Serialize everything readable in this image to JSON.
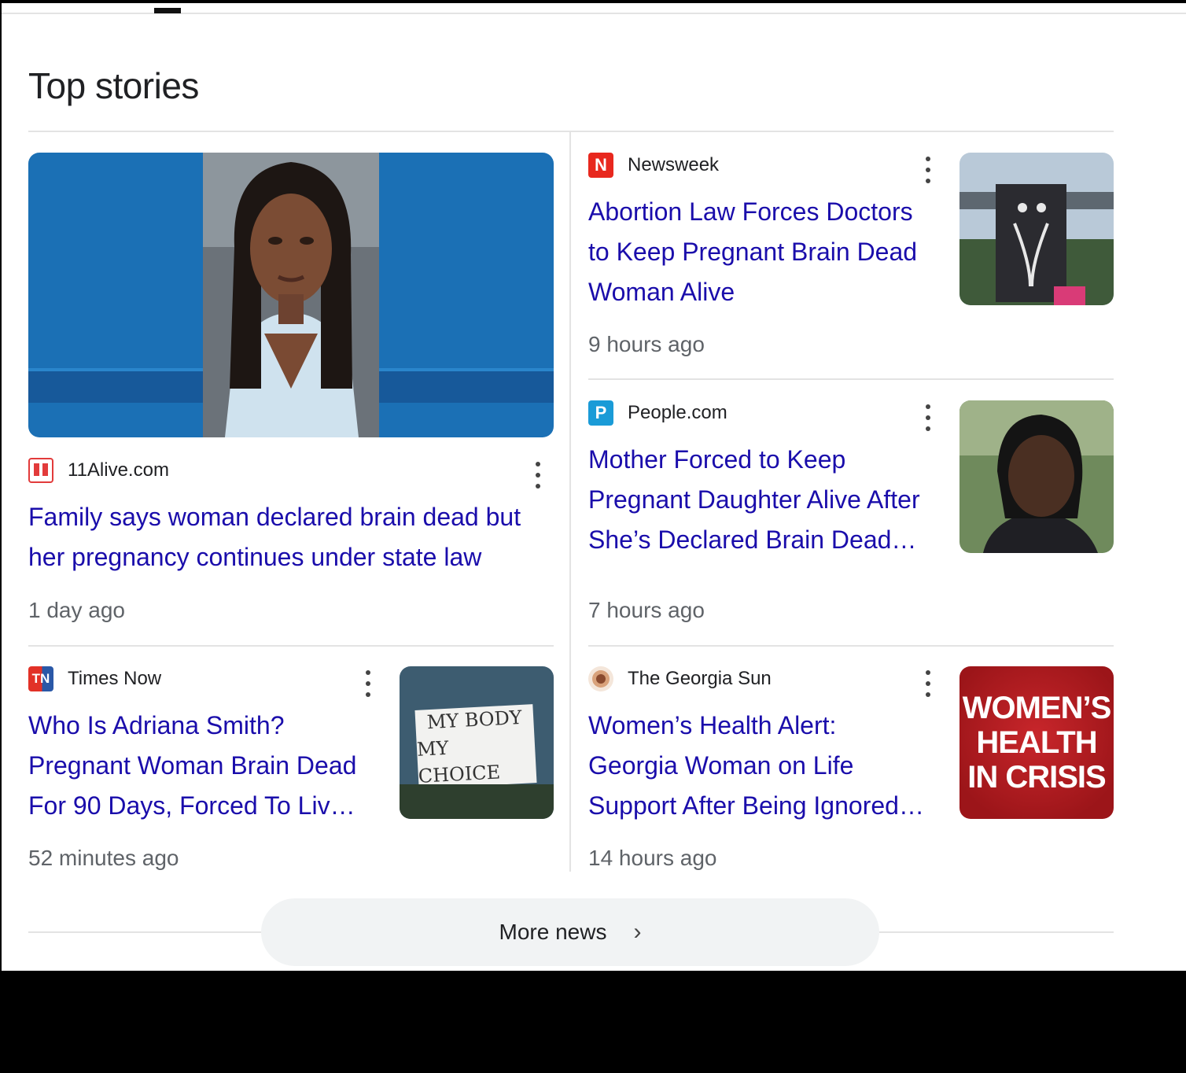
{
  "section_title": "Top stories",
  "stories": [
    {
      "source": "11Alive.com",
      "source_icon": "11alive-logo-icon",
      "headline_lines": [
        "Family says woman declared brain dead but",
        "her pregnancy continues under state law"
      ],
      "time": "1 day ago"
    },
    {
      "source": "Newsweek",
      "source_icon": "newsweek-logo-icon",
      "icon_letter": "N",
      "headline_lines": [
        "Abortion Law Forces Doctors",
        "to Keep Pregnant Brain Dead",
        "Woman Alive"
      ],
      "time": "9 hours ago"
    },
    {
      "source": "People.com",
      "source_icon": "people-logo-icon",
      "icon_letter": "P",
      "headline_lines": [
        "Mother Forced to Keep",
        "Pregnant Daughter Alive After",
        "She’s Declared Brain Dead…"
      ],
      "time": "7 hours ago"
    },
    {
      "source": "Times Now",
      "source_icon": "timesnow-logo-icon",
      "icon_letter": "TN",
      "headline_lines": [
        "Who Is Adriana Smith?",
        "Pregnant Woman Brain Dead",
        "For 90 Days, Forced To Liv…"
      ],
      "time": "52 minutes ago",
      "image_text": [
        "MY BODY",
        "MY CHOICE"
      ]
    },
    {
      "source": "The Georgia Sun",
      "source_icon": "georgiasun-logo-icon",
      "headline_lines": [
        "Women’s Health Alert:",
        "Georgia Woman on Life",
        "Support After Being Ignored…"
      ],
      "time": "14 hours ago",
      "image_text": [
        "WOMEN’S",
        "HEALTH",
        "IN CRISIS"
      ]
    }
  ],
  "more_news": {
    "label": "More news",
    "icon": "chevron-right-icon"
  },
  "colors": {
    "link": "#1a0dab",
    "meta": "#5f6368",
    "newsweek": "#e8281e",
    "people": "#1a9bd7",
    "timesnow_red": "#e23127",
    "timesnow_blue": "#2a58a7",
    "crisis_red": "#b1191f"
  }
}
